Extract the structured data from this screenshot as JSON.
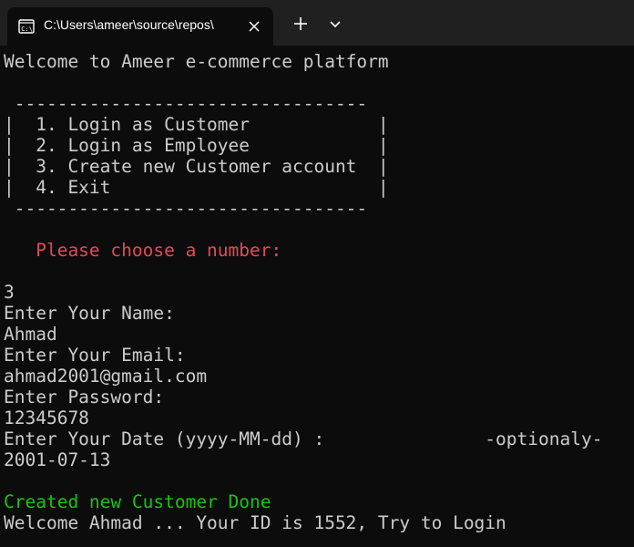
{
  "window": {
    "tab_title": "C:\\Users\\ameer\\source\\repos\\",
    "tab_icon": "terminal-icon",
    "close_icon": "close-icon",
    "new_tab_icon": "plus-icon",
    "dropdown_icon": "chevron-down-icon"
  },
  "terminal": {
    "lines": [
      "Welcome to Ameer e-commerce platform",
      "",
      " ---------------------------------",
      "|  1. Login as Customer            |",
      "|  2. Login as Employee            |",
      "|  3. Create new Customer account  |",
      "|  4. Exit                         |",
      " ---------------------------------",
      "",
      "   Please choose a number:",
      "",
      "3",
      "Enter Your Name:",
      "Ahmad",
      "Enter Your Email:",
      "ahmad2001@gmail.com",
      "Enter Password:",
      "12345678",
      "Enter Your Date (yyyy-MM-dd) :               -optionaly-",
      "2001-07-13",
      "",
      "Created new Customer Done",
      "Welcome Ahmad ... Your ID is 1552, Try to Login"
    ]
  },
  "colors": {
    "background": "#0c0c0c",
    "text": "#cccccc",
    "prompt_red": "#e74856",
    "success_green": "#16c60c",
    "titlebar": "#202020"
  }
}
